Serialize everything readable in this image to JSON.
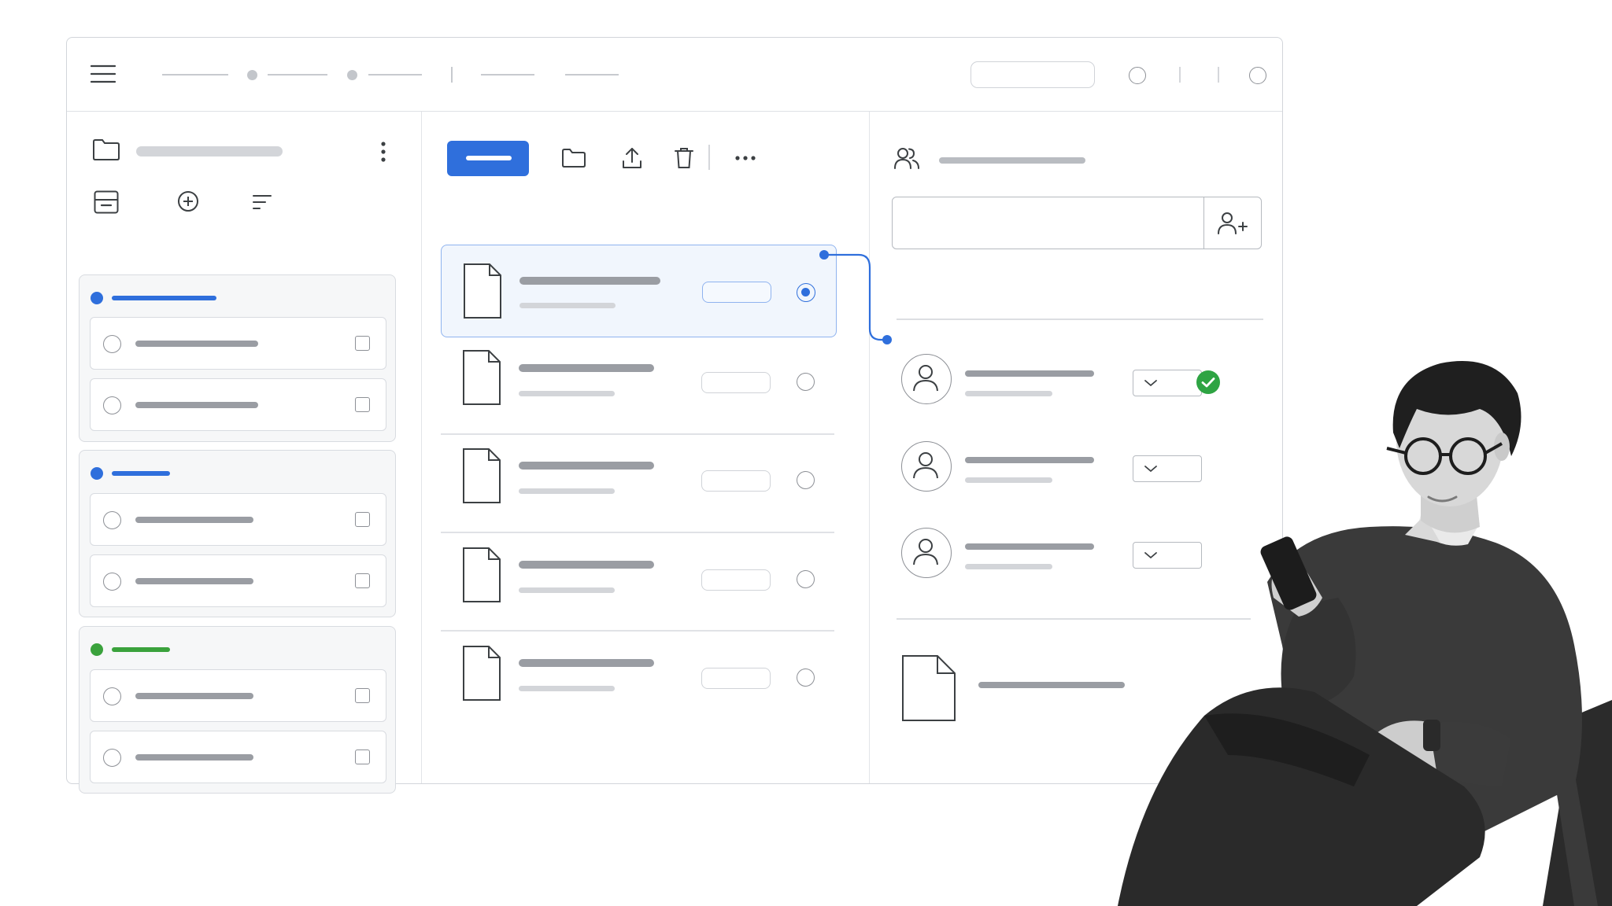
{
  "app": {
    "accent": "#2f6fdc",
    "success": "#2ea443",
    "success_dot": "#3aa23c",
    "window_border": "#d2d5da"
  },
  "topbar": {
    "icons": [
      "menu-icon",
      "search-icon",
      "account-icon"
    ]
  },
  "left_panel": {
    "header_icons": [
      "folder-icon",
      "kebab-menu-icon"
    ],
    "toolbar_icons": [
      "archive-icon",
      "add-circle-icon",
      "sort-icon"
    ],
    "groups": [
      {
        "color": "#2f6fdc",
        "items": 2
      },
      {
        "color": "#2f6fdc",
        "items": 2
      },
      {
        "color": "#3aa23c",
        "items": 2
      }
    ]
  },
  "middle_panel": {
    "toolbar_icons": [
      "folder-icon",
      "upload-icon",
      "trash-icon",
      "more-icon"
    ],
    "rows": 5,
    "selected_row": 0
  },
  "right_panel": {
    "header_icon": "users-icon",
    "invite_icon": "add-user-icon",
    "members": 3,
    "confirmed_member": 0,
    "attachment_icon": "document-icon"
  }
}
